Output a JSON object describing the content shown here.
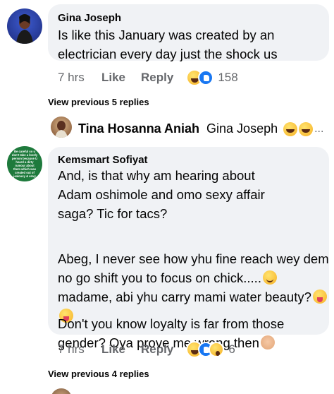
{
  "comment1": {
    "author": "Gina Joseph",
    "text": "Is like this January was created by an electrician every day just the shock us",
    "time": "7 hrs",
    "like_label": "Like",
    "reply_label": "Reply",
    "reaction_count": "158"
  },
  "view_previous_1": "View previous 5 replies",
  "collapsed_reply": {
    "author": "Tina Hosanna Aniah",
    "preview": "Gina Joseph",
    "ellipsis": "..."
  },
  "comment2": {
    "author": "Kemsmart Sofiyat",
    "avatar_text": "Be careful so u don't take a lovely person because U heard a dirty rumour about them which was created out of jealousy & envy",
    "para1": "And, is that why am hearing about Adam oshimole and omo sexy  affair saga? Tic for tacs?",
    "para2": "Abeg, I never see how yhu fine reach wey dem no go shift you to focus on chick.....",
    "para2b": " madame, abi yhu carry mami water beauty?",
    "para3": "Don't you know loyalty is far from those gender? Oya prove me wrong then",
    "time": "7 hrs",
    "like_label": "Like",
    "reply_label": "Reply",
    "reaction_count": "6"
  },
  "view_previous_2": "View previous 4 replies",
  "colors": {
    "bubble": "#f0f2f5",
    "meta": "#65676b",
    "like_blue": "#1877f2"
  },
  "icons": [
    "haha-reaction-icon",
    "like-reaction-icon",
    "wow-reaction-icon",
    "laughing-emoji",
    "smile-emoji",
    "tongue-emoji",
    "facepalm-emoji"
  ]
}
